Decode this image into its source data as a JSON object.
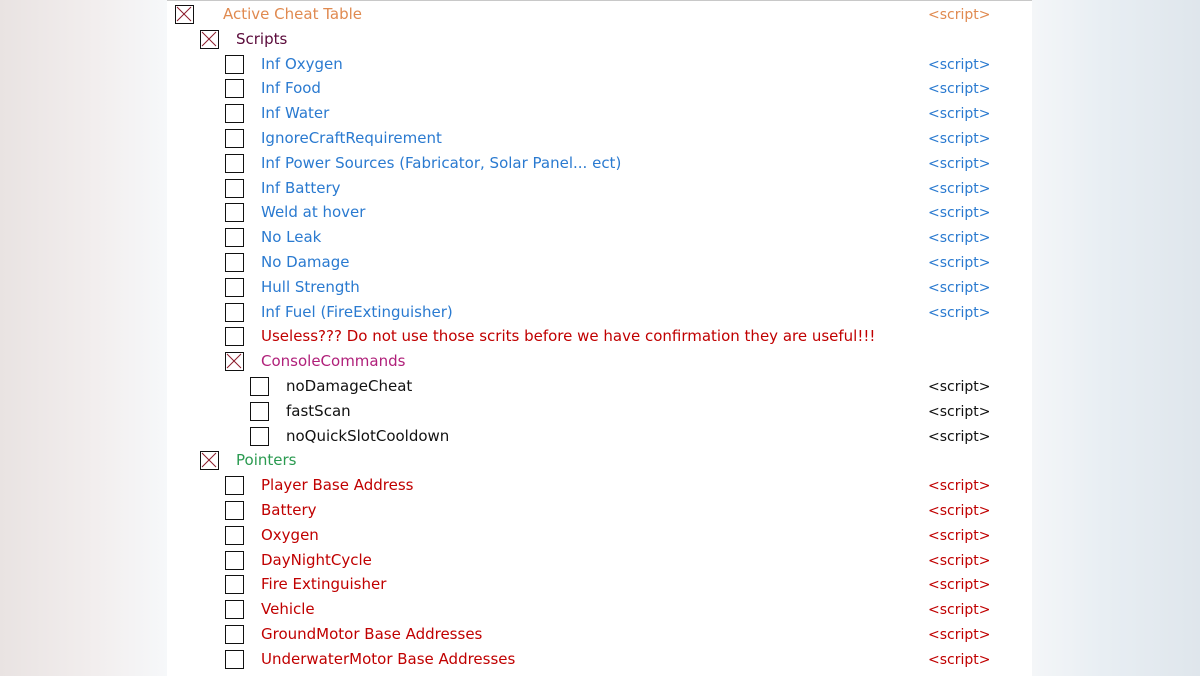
{
  "colors": {
    "header": "#e08a50",
    "group": "#5a0a3a",
    "blue": "#2a7ad0",
    "red": "#c00000",
    "pink": "#b0207a",
    "black": "#111111",
    "green": "#2a9a50"
  },
  "rows": [
    {
      "label": "Active Cheat Table",
      "value": "<script>",
      "level": 0,
      "checked": true,
      "color": "header"
    },
    {
      "label": "Scripts",
      "value": "",
      "level": 1,
      "checked": true,
      "color": "group"
    },
    {
      "label": "Inf Oxygen",
      "value": "<script>",
      "level": 2,
      "checked": false,
      "color": "blue"
    },
    {
      "label": "Inf Food",
      "value": "<script>",
      "level": 2,
      "checked": false,
      "color": "blue"
    },
    {
      "label": "Inf Water",
      "value": "<script>",
      "level": 2,
      "checked": false,
      "color": "blue"
    },
    {
      "label": "IgnoreCraftRequirement",
      "value": "<script>",
      "level": 2,
      "checked": false,
      "color": "blue"
    },
    {
      "label": "Inf Power Sources (Fabricator, Solar Panel... ect)",
      "value": "<script>",
      "level": 2,
      "checked": false,
      "color": "blue"
    },
    {
      "label": "Inf Battery",
      "value": "<script>",
      "level": 2,
      "checked": false,
      "color": "blue"
    },
    {
      "label": "Weld at hover",
      "value": "<script>",
      "level": 2,
      "checked": false,
      "color": "blue"
    },
    {
      "label": "No Leak",
      "value": "<script>",
      "level": 2,
      "checked": false,
      "color": "blue"
    },
    {
      "label": "No Damage",
      "value": "<script>",
      "level": 2,
      "checked": false,
      "color": "blue"
    },
    {
      "label": "Hull Strength",
      "value": "<script>",
      "level": 2,
      "checked": false,
      "color": "blue"
    },
    {
      "label": "Inf Fuel (FireExtinguisher)",
      "value": "<script>",
      "level": 2,
      "checked": false,
      "color": "blue"
    },
    {
      "label": "Useless??? Do not use those scrits before we have confirmation they are useful!!!",
      "value": "",
      "level": 2,
      "checked": false,
      "color": "red"
    },
    {
      "label": "ConsoleCommands",
      "value": "",
      "level": 2,
      "checked": true,
      "color": "pink"
    },
    {
      "label": "noDamageCheat",
      "value": "<script>",
      "level": 3,
      "checked": false,
      "color": "black"
    },
    {
      "label": "fastScan",
      "value": "<script>",
      "level": 3,
      "checked": false,
      "color": "black"
    },
    {
      "label": "noQuickSlotCooldown",
      "value": "<script>",
      "level": 3,
      "checked": false,
      "color": "black"
    },
    {
      "label": "Pointers",
      "value": "",
      "level": 1,
      "checked": true,
      "color": "green"
    },
    {
      "label": "Player Base Address",
      "value": "<script>",
      "level": 2,
      "checked": false,
      "color": "red"
    },
    {
      "label": "Battery",
      "value": "<script>",
      "level": 2,
      "checked": false,
      "color": "red"
    },
    {
      "label": "Oxygen",
      "value": "<script>",
      "level": 2,
      "checked": false,
      "color": "red"
    },
    {
      "label": "DayNightCycle",
      "value": "<script>",
      "level": 2,
      "checked": false,
      "color": "red"
    },
    {
      "label": "Fire Extinguisher",
      "value": "<script>",
      "level": 2,
      "checked": false,
      "color": "red"
    },
    {
      "label": "Vehicle",
      "value": "<script>",
      "level": 2,
      "checked": false,
      "color": "red"
    },
    {
      "label": "GroundMotor Base Addresses",
      "value": "<script>",
      "level": 2,
      "checked": false,
      "color": "red"
    },
    {
      "label": "UnderwaterMotor Base Addresses",
      "value": "<script>",
      "level": 2,
      "checked": false,
      "color": "red"
    }
  ]
}
